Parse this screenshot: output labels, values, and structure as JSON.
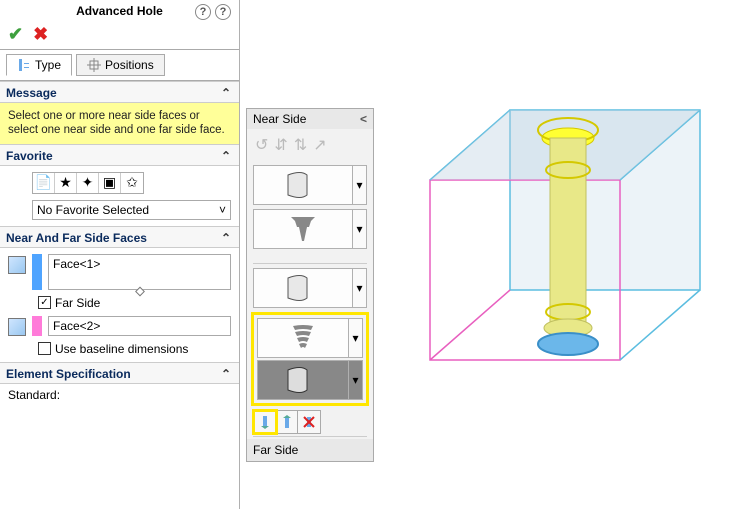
{
  "header": {
    "title": "Advanced Hole"
  },
  "tabs": {
    "type_label": "Type",
    "positions_label": "Positions",
    "active": "type"
  },
  "message": {
    "header": "Message",
    "text": "Select one or more near side faces or select one near side and one far side face."
  },
  "favorite": {
    "header": "Favorite",
    "icons": [
      "favorite-new-icon",
      "favorite-add-icon",
      "favorite-delete-icon",
      "favorite-save-icon",
      "favorite-load-icon"
    ],
    "selection": "No Favorite Selected"
  },
  "faces": {
    "header": "Near And Far Side Faces",
    "near_label": "Face<1>",
    "near_swatch_color": "#4fa4ff",
    "far_side_checked": true,
    "far_side_label": "Far Side",
    "far_label": "Face<2>",
    "far_swatch_color": "#ff7bd9",
    "baseline_checked": false,
    "baseline_label": "Use baseline dimensions"
  },
  "element_spec": {
    "header": "Element Specification",
    "standard_label": "Standard:"
  },
  "nearside": {
    "header": "Near Side",
    "tool_icons": [
      "ns-tool-1",
      "ns-tool-2",
      "ns-tool-3",
      "ns-tool-4"
    ],
    "items": [
      {
        "name": "profile-straight",
        "type": "flag"
      },
      {
        "name": "profile-screw",
        "type": "screw"
      },
      {
        "name": "profile-straight-2",
        "type": "flag"
      },
      {
        "name": "profile-helix",
        "type": "helix",
        "highlight": true
      },
      {
        "name": "profile-straight-3",
        "type": "flag",
        "highlight": true,
        "dim": true
      }
    ],
    "action_icons": [
      "insert-above-icon",
      "insert-below-icon",
      "delete-icon"
    ],
    "action_highlight_index": 0,
    "far_side_label": "Far Side"
  }
}
